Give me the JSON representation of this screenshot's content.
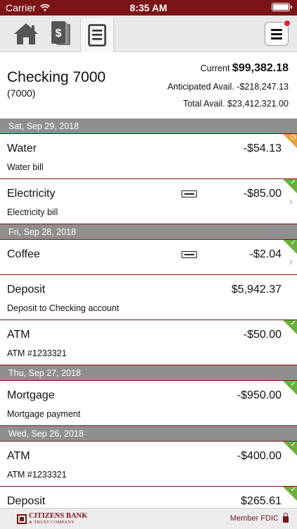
{
  "status_bar": {
    "carrier": "Carrier",
    "time": "8:35 AM"
  },
  "nav": {
    "tabs": [
      {
        "name": "home",
        "icon": "house-icon"
      },
      {
        "name": "deposit",
        "icon": "dollar-check-icon"
      },
      {
        "name": "register",
        "icon": "register-list-icon",
        "selected": true
      }
    ],
    "menu_icon": "hamburger-menu-icon",
    "menu_has_notification": true
  },
  "account": {
    "name": "Checking 7000",
    "number": "(7000)",
    "current_label": "Current",
    "current_value": "$99,382.18",
    "anticipated_label": "Anticipated Avail.",
    "anticipated_value": "-$218,247.13",
    "total_label": "Total Avail.",
    "total_value": "$23,412,321.00"
  },
  "groups": [
    {
      "date": "Sat, Sep 29, 2018",
      "transactions": [
        {
          "title": "Water",
          "desc": "Water bill",
          "amount": "-$54.13",
          "status": "pending",
          "memo": false,
          "chevron": false
        },
        {
          "title": "Electricity",
          "desc": "Electricity bill",
          "amount": "-$85.00",
          "status": "cleared",
          "memo": true,
          "chevron": true
        }
      ]
    },
    {
      "date": "Fri, Sep 28, 2018",
      "transactions": [
        {
          "title": "Coffee",
          "desc": "",
          "amount": "-$2.04",
          "status": "cleared",
          "memo": true,
          "chevron": true
        },
        {
          "title": "Deposit",
          "desc": "Deposit to Checking account",
          "amount": "$5,942.37",
          "status": "none",
          "memo": false,
          "chevron": false
        },
        {
          "title": "ATM",
          "desc": "ATM #1233321",
          "amount": "-$50.00",
          "status": "cleared",
          "memo": false,
          "chevron": false
        }
      ]
    },
    {
      "date": "Thu, Sep 27, 2018",
      "transactions": [
        {
          "title": "Mortgage",
          "desc": "Mortgage payment",
          "amount": "-$950.00",
          "status": "cleared",
          "memo": false,
          "chevron": false
        }
      ]
    },
    {
      "date": "Wed, Sep 26, 2018",
      "transactions": [
        {
          "title": "ATM",
          "desc": "ATM #1233321",
          "amount": "-$400.00",
          "status": "cleared",
          "memo": false,
          "chevron": false
        },
        {
          "title": "Deposit",
          "desc": "",
          "amount": "$265.61",
          "status": "cleared",
          "memo": false,
          "chevron": false
        }
      ]
    }
  ],
  "footer": {
    "logo_line1": "CITIZENS BANK",
    "logo_line2": "& TRUST COMPANY",
    "fdic": "Member FDIC",
    "lock_icon": "lock-icon"
  },
  "colors": {
    "brand": "#7a1416",
    "date_header": "#8f8f8f",
    "cleared": "#6bb03a",
    "pending": "#e4a23a"
  }
}
